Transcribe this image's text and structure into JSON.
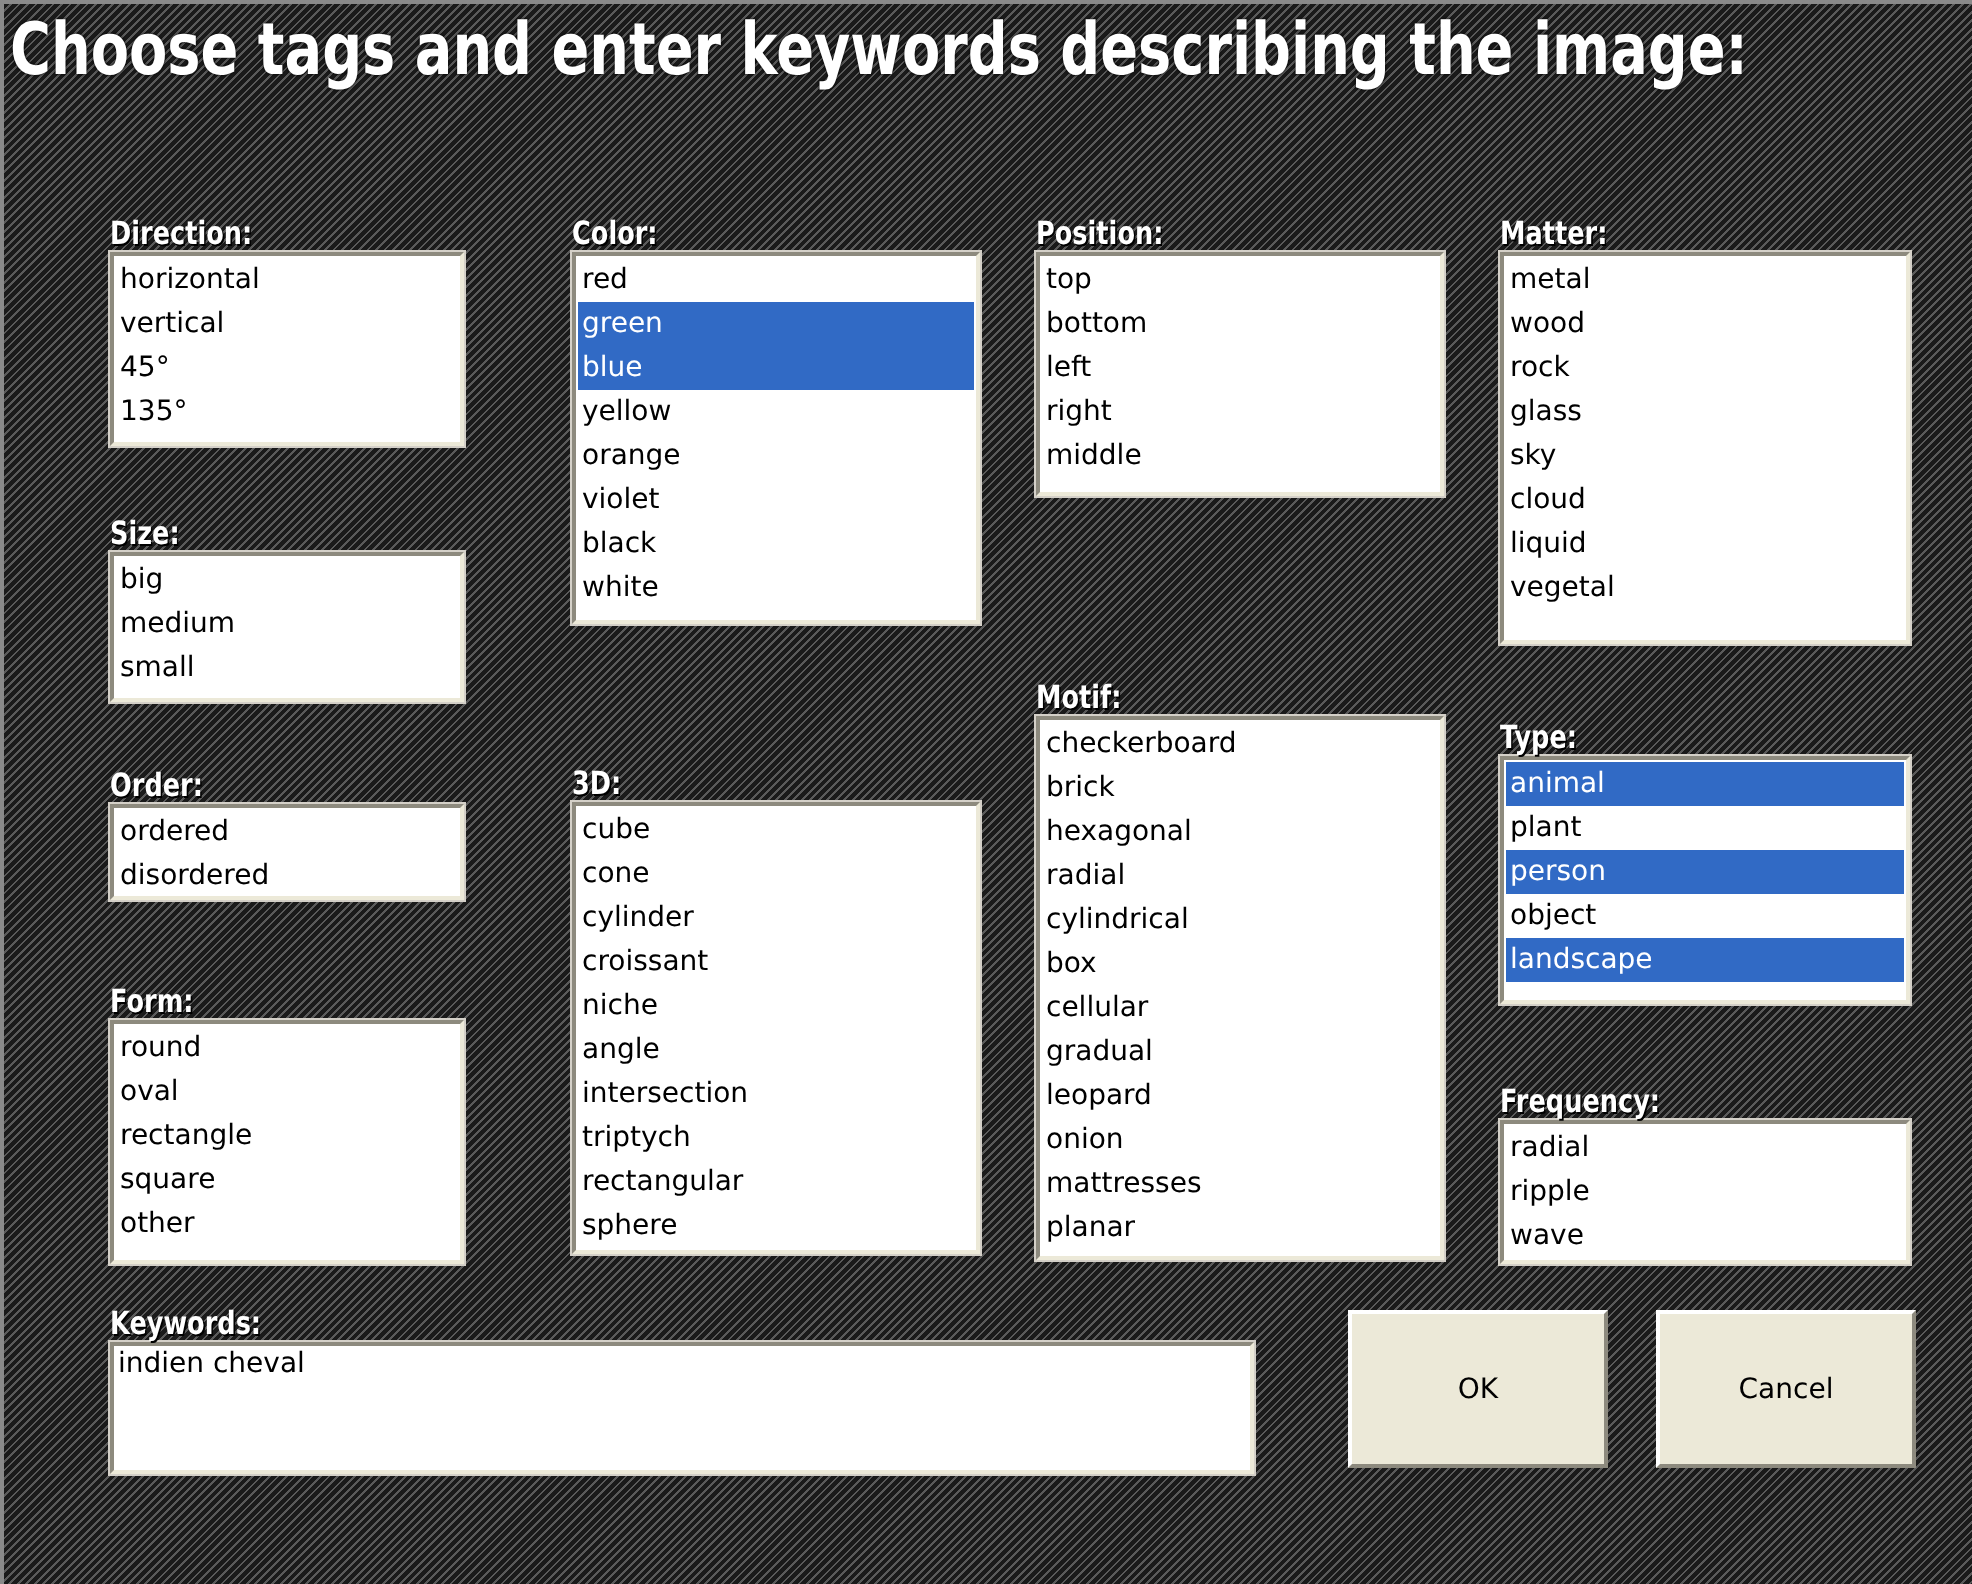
{
  "title": "Choose tags and enter keywords describing the image:",
  "columns": [
    {
      "groups": [
        {
          "label": "Direction:",
          "items": [
            {
              "text": "horizontal",
              "selected": false
            },
            {
              "text": "vertical",
              "selected": false
            },
            {
              "text": "45°",
              "selected": false
            },
            {
              "text": "135°",
              "selected": false
            }
          ]
        },
        {
          "label": "Size:",
          "items": [
            {
              "text": "big",
              "selected": false
            },
            {
              "text": "medium",
              "selected": false
            },
            {
              "text": "small",
              "selected": false
            }
          ]
        },
        {
          "label": "Order:",
          "items": [
            {
              "text": "ordered",
              "selected": false
            },
            {
              "text": "disordered",
              "selected": false
            }
          ]
        },
        {
          "label": "Form:",
          "items": [
            {
              "text": "round",
              "selected": false
            },
            {
              "text": "oval",
              "selected": false
            },
            {
              "text": "rectangle",
              "selected": false
            },
            {
              "text": "square",
              "selected": false
            },
            {
              "text": "other",
              "selected": false
            }
          ]
        }
      ]
    },
    {
      "groups": [
        {
          "label": "Color:",
          "items": [
            {
              "text": "red",
              "selected": false
            },
            {
              "text": "green",
              "selected": true
            },
            {
              "text": "blue",
              "selected": true
            },
            {
              "text": "yellow",
              "selected": false
            },
            {
              "text": "orange",
              "selected": false
            },
            {
              "text": "violet",
              "selected": false
            },
            {
              "text": "black",
              "selected": false
            },
            {
              "text": "white",
              "selected": false
            }
          ]
        },
        {
          "label": "3D:",
          "items": [
            {
              "text": "cube",
              "selected": false
            },
            {
              "text": "cone",
              "selected": false
            },
            {
              "text": "cylinder",
              "selected": false
            },
            {
              "text": "croissant",
              "selected": false
            },
            {
              "text": "niche",
              "selected": false
            },
            {
              "text": "angle",
              "selected": false
            },
            {
              "text": "intersection",
              "selected": false
            },
            {
              "text": "triptych",
              "selected": false
            },
            {
              "text": "rectangular",
              "selected": false
            },
            {
              "text": "sphere",
              "selected": false
            }
          ]
        }
      ]
    },
    {
      "groups": [
        {
          "label": "Position:",
          "items": [
            {
              "text": "top",
              "selected": false
            },
            {
              "text": "bottom",
              "selected": false
            },
            {
              "text": "left",
              "selected": false
            },
            {
              "text": "right",
              "selected": false
            },
            {
              "text": "middle",
              "selected": false
            }
          ]
        },
        {
          "label": "Motif:",
          "items": [
            {
              "text": "checkerboard",
              "selected": false
            },
            {
              "text": "brick",
              "selected": false
            },
            {
              "text": "hexagonal",
              "selected": false
            },
            {
              "text": "radial",
              "selected": false
            },
            {
              "text": "cylindrical",
              "selected": false
            },
            {
              "text": "box",
              "selected": false
            },
            {
              "text": "cellular",
              "selected": false
            },
            {
              "text": "gradual",
              "selected": false
            },
            {
              "text": "leopard",
              "selected": false
            },
            {
              "text": "onion",
              "selected": false
            },
            {
              "text": "mattresses",
              "selected": false
            },
            {
              "text": "planar",
              "selected": false
            }
          ]
        }
      ]
    },
    {
      "groups": [
        {
          "label": "Matter:",
          "items": [
            {
              "text": "metal",
              "selected": false
            },
            {
              "text": "wood",
              "selected": false
            },
            {
              "text": "rock",
              "selected": false
            },
            {
              "text": "glass",
              "selected": false
            },
            {
              "text": "sky",
              "selected": false
            },
            {
              "text": "cloud",
              "selected": false
            },
            {
              "text": "liquid",
              "selected": false
            },
            {
              "text": "vegetal",
              "selected": false
            }
          ]
        },
        {
          "label": "Type:",
          "items": [
            {
              "text": "animal",
              "selected": true
            },
            {
              "text": "plant",
              "selected": false
            },
            {
              "text": "person",
              "selected": true
            },
            {
              "text": "object",
              "selected": false
            },
            {
              "text": "landscape",
              "selected": true
            }
          ]
        },
        {
          "label": "Frequency:",
          "items": [
            {
              "text": "radial",
              "selected": false
            },
            {
              "text": "ripple",
              "selected": false
            },
            {
              "text": "wave",
              "selected": false
            }
          ]
        }
      ]
    }
  ],
  "keywords": {
    "label": "Keywords:",
    "value": "indien cheval"
  },
  "buttons": [
    "OK",
    "Cancel"
  ]
}
